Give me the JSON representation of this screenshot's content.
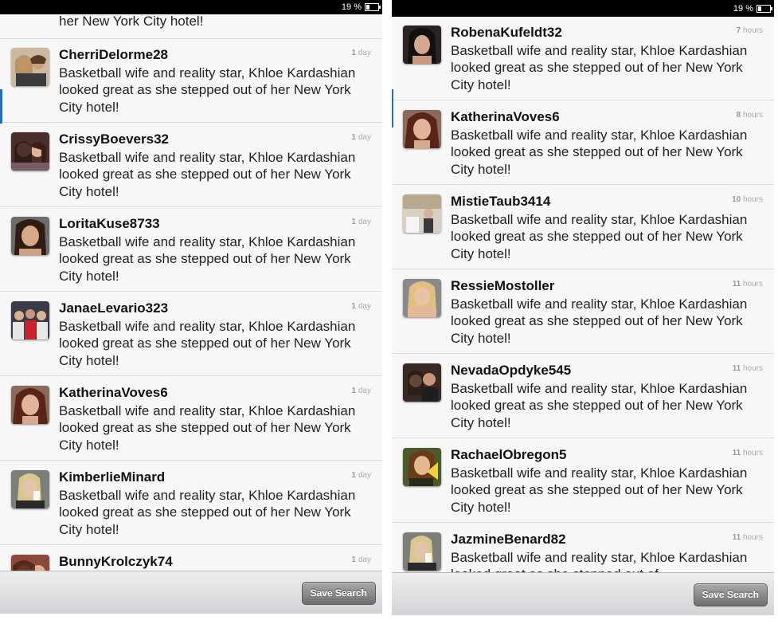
{
  "status": {
    "battery": "19 %"
  },
  "left_panel": {
    "partial_top_text": "her New York City hotel!",
    "items": [
      {
        "username": "CherriDelorme28",
        "time_num": "1",
        "time_unit": "day",
        "text": "Basketball wife and reality star, Khloe Kardashian looked great as she stepped out of her New York City hotel!"
      },
      {
        "username": "CrissyBoevers32",
        "time_num": "1",
        "time_unit": "day",
        "text": "Basketball wife and reality star, Khloe Kardashian looked great as she stepped out of her New York City hotel!"
      },
      {
        "username": "LoritaKuse8733",
        "time_num": "1",
        "time_unit": "day",
        "text": "Basketball wife and reality star, Khloe Kardashian looked great as she stepped out of her New York City hotel!"
      },
      {
        "username": "JanaeLevario323",
        "time_num": "1",
        "time_unit": "day",
        "text": "Basketball wife and reality star, Khloe Kardashian looked great as she stepped out of her New York City hotel!"
      },
      {
        "username": "KatherinaVoves6",
        "time_num": "1",
        "time_unit": "day",
        "text": "Basketball wife and reality star, Khloe Kardashian looked great as she stepped out of her New York City hotel!"
      },
      {
        "username": "KimberlieMinard",
        "time_num": "1",
        "time_unit": "day",
        "text": "Basketball wife and reality star, Khloe Kardashian looked great as she stepped out of her New York City hotel!"
      },
      {
        "username": "BunnyKrolczyk74",
        "time_num": "1",
        "time_unit": "day",
        "text": ""
      }
    ],
    "save_label": "Save Search"
  },
  "right_panel": {
    "items": [
      {
        "username": "RobenaKufeldt32",
        "time_num": "7",
        "time_unit": "hours",
        "text": "Basketball wife and reality star, Khloe Kardashian looked great as she stepped out of her New York City hotel!"
      },
      {
        "username": "KatherinaVoves6",
        "time_num": "8",
        "time_unit": "hours",
        "text": "Basketball wife and reality star, Khloe Kardashian looked great as she stepped out of her New York City hotel!"
      },
      {
        "username": "MistieTaub3414",
        "time_num": "10",
        "time_unit": "hours",
        "text": "Basketball wife and reality star, Khloe Kardashian looked great as she stepped out of her New York City hotel!"
      },
      {
        "username": "RessieMostoller",
        "time_num": "11",
        "time_unit": "hours",
        "text": "Basketball wife and reality star, Khloe Kardashian looked great as she stepped out of her New York City hotel!"
      },
      {
        "username": "NevadaOpdyke545",
        "time_num": "11",
        "time_unit": "hours",
        "text": "Basketball wife and reality star, Khloe Kardashian looked great as she stepped out of her New York City hotel!"
      },
      {
        "username": "RachaelObregon5",
        "time_num": "11",
        "time_unit": "hours",
        "text": "Basketball wife and reality star, Khloe Kardashian looked great as she stepped out of her New York City hotel!"
      },
      {
        "username": "JazmineBenard82",
        "time_num": "11",
        "time_unit": "hours",
        "text": "Basketball wife and reality star, Khloe Kardashian looked great as she stepped out of"
      }
    ],
    "save_label": "Save Search"
  },
  "colors": {
    "accent": "#2a6fb5",
    "list_bg": "#f7f7f7",
    "button": "#8a8a8a"
  }
}
